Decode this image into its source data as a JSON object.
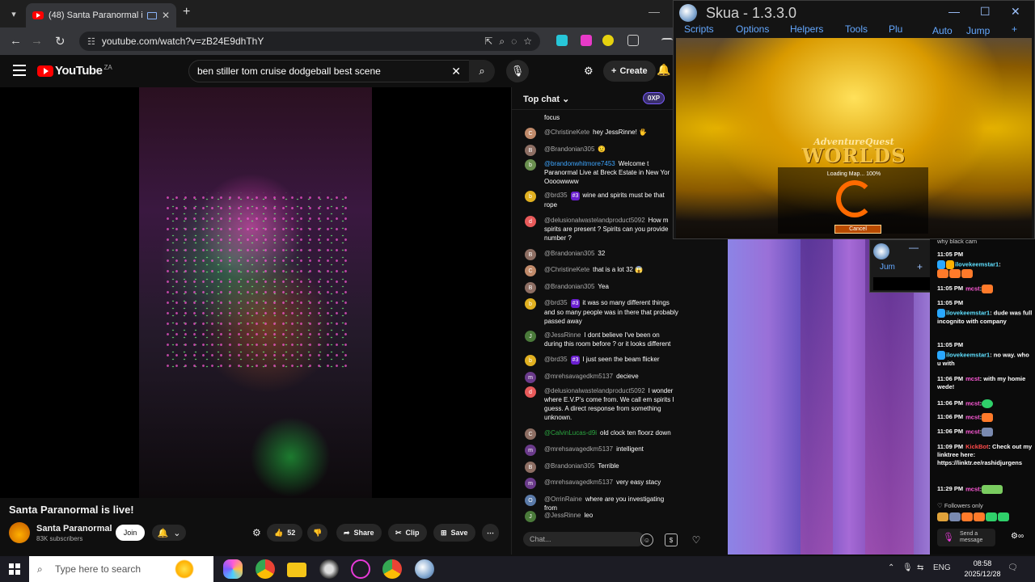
{
  "browser": {
    "tab_title": "(48) Santa Paranormal is live!",
    "url": "youtube.com/watch?v=zB24E9dhThY"
  },
  "youtube": {
    "logo_text": "YouTube",
    "country": "ZA",
    "search_query": "ben stiller tom cruise dodgeball best scene",
    "create_label": "Create"
  },
  "video": {
    "title": "Santa Paranormal is live!",
    "channel": "Santa Paranormal",
    "subscribers": "83K subscribers",
    "join_label": "Join",
    "like_count": "52",
    "share_label": "Share",
    "clip_label": "Clip",
    "save_label": "Save"
  },
  "chat": {
    "header": "Top chat",
    "xp": "0XP",
    "input_placeholder": "Chat...",
    "messages": [
      {
        "author": "",
        "text": "focus"
      },
      {
        "author": "@ChristineKete",
        "text": "hey JessRinne! 🖐"
      },
      {
        "author": "@Brandonian305",
        "text": "😟"
      },
      {
        "author": "@brandonwhitmore7453",
        "text": "Welcome t Paranormal Live at Breck Estate in New Yor Oooowwww"
      },
      {
        "author": "@brd35",
        "badge": "#3",
        "text": "wine and spirits must be that rope"
      },
      {
        "author": "@delusionalwastelandproduct5092",
        "text": "How m spirits are present ? Spirits can you provide number ?"
      },
      {
        "author": "@Brandonian305",
        "text": "32"
      },
      {
        "author": "@ChristineKete",
        "text": "that is a lot 32 😱"
      },
      {
        "author": "@Brandonian305",
        "text": "Yea"
      },
      {
        "author": "@brd35",
        "badge": "#3",
        "text": "it was so many different things and so many people was in there that probably passed away"
      },
      {
        "author": "@JessRinne",
        "text": "I dont believe I've been on during this room before ? or it looks different"
      },
      {
        "author": "@brd35",
        "badge": "#3",
        "text": "I just seen the beam flicker"
      },
      {
        "author": "@mrehsavagedkm5137",
        "text": "decieve"
      },
      {
        "author": "@delusionalwastelandproduct5092",
        "text": "I wonder where E.V.P's come from. We call em spirits I guess. A direct response from something unknown."
      },
      {
        "author": "@CalvinLucas-d9i",
        "text": "old clock ten floorz down"
      },
      {
        "author": "@mrehsavagedkm5137",
        "text": "intelligent"
      },
      {
        "author": "@Brandonian305",
        "text": "Terrible"
      },
      {
        "author": "@mrehsavagedkm5137",
        "text": "very easy stacy"
      },
      {
        "author": "@OrrinRaine",
        "text": "where are you investigating from"
      },
      {
        "author": "@JessRinne",
        "text": "leo"
      }
    ]
  },
  "skua": {
    "title": "Skua - 1.3.3.0",
    "menu": [
      "Scripts",
      "Options",
      "Helpers",
      "Tools",
      "Plu",
      "Auto",
      "Jump"
    ],
    "plus": "+",
    "game_logo_top": "AdventureQuest",
    "game_logo_bottom": "WORLDS",
    "loading_text": "Loading Map... 100%",
    "cancel_label": "Cancel"
  },
  "mini_skua": {
    "label": "Jum"
  },
  "kick": {
    "top_text": "why black cam",
    "messages": [
      {
        "time": "11:05 PM",
        "user": "",
        "text": ""
      },
      {
        "time": "",
        "user": "ilovekeemstar1",
        "text": ":"
      },
      {
        "time": "11:05 PM",
        "user": "mcst",
        "text": ":"
      },
      {
        "time": "11:05 PM",
        "user": "",
        "text": ""
      },
      {
        "time": "",
        "user": "ilovekeemstar1",
        "text": ": dude was full incognito with company"
      },
      {
        "time": "11:05 PM",
        "user": "",
        "text": ""
      },
      {
        "time": "",
        "user": "ilovekeemstar1",
        "text": ": no way. who u with"
      },
      {
        "time": "11:06 PM",
        "user": "mcst",
        "text": ": with my homie wede!"
      },
      {
        "time": "11:06 PM",
        "user": "mcst",
        "text": ":"
      },
      {
        "time": "11:06 PM",
        "user": "mcst",
        "text": ":"
      },
      {
        "time": "11:06 PM",
        "user": "mcst",
        "text": ":"
      },
      {
        "time": "11:09 PM",
        "user": "KickBot",
        "text": ": Check out my linktree here: https://linktr.ee/rashidjurgens"
      },
      {
        "time": "11:29 PM",
        "user": "mcst",
        "text": ":"
      }
    ],
    "followers_only": "Followers only",
    "send_placeholder": "Send a message"
  },
  "taskbar": {
    "search_placeholder": "Type here to search",
    "language": "ENG",
    "time": "08:58",
    "date": "2025/12/28"
  }
}
